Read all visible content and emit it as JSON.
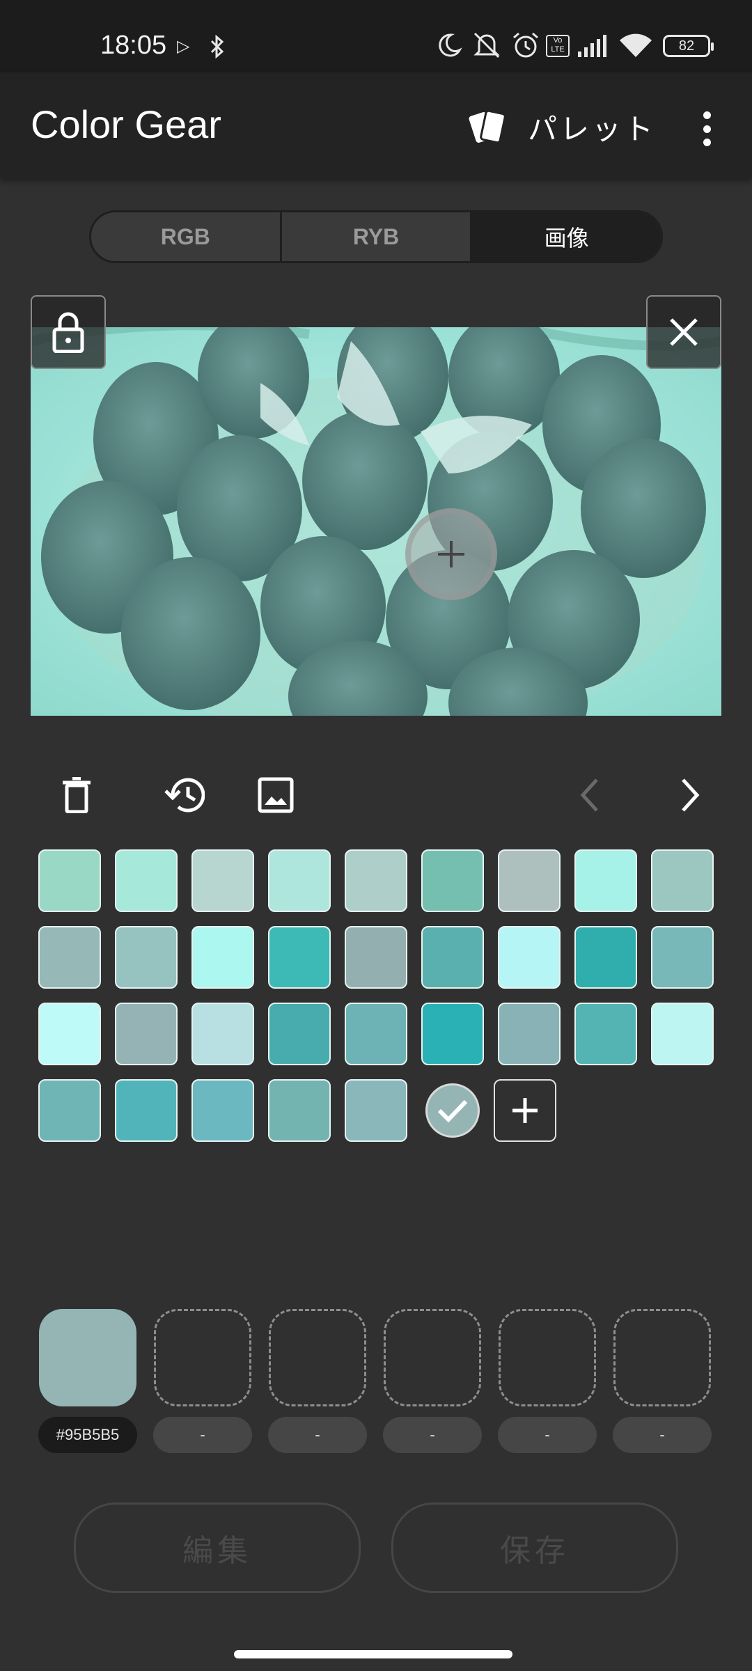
{
  "status_bar": {
    "time": "18:05",
    "battery": "82",
    "icons": [
      "play-store-icon",
      "bluetooth-icon",
      "moon-icon",
      "bell-off-icon",
      "alarm-icon",
      "volte-icon",
      "signal-icon",
      "wifi-icon",
      "battery-icon"
    ]
  },
  "app_bar": {
    "title": "Color Gear",
    "palette_label": "パレット"
  },
  "tabs": [
    {
      "label": "RGB",
      "active": false
    },
    {
      "label": "RYB",
      "active": false
    },
    {
      "label": "画像",
      "active": true
    }
  ],
  "swatches": [
    "#9AD8C6",
    "#A6E8DA",
    "#B8D6D0",
    "#AEE6DE",
    "#AECFC9",
    "#74BFB0",
    "#AEC0BE",
    "#A6F2E9",
    "#9CC7C1",
    "#96B8B7",
    "#96C2BF",
    "#ADF7F1",
    "#3DBAB6",
    "#94AFB0",
    "#5AAFAF",
    "#B6F5F5",
    "#2FAEAD",
    "#78B8B8",
    "#BDFAF8",
    "#95B3B4",
    "#B8E0E3",
    "#48ABAE",
    "#6DB3B5",
    "#2AB1B6",
    "#88B2B5",
    "#54B4B4",
    "#BDF5F2",
    "#6FB5B5",
    "#52B4BB",
    "#6BB8C0",
    "#73B3B0",
    "#8AB8BA"
  ],
  "selected_swatch_color": "#95B5B5",
  "slots": [
    {
      "color": "#95B5B5",
      "label": "#95B5B5",
      "filled": true
    },
    {
      "label": "-",
      "filled": false
    },
    {
      "label": "-",
      "filled": false
    },
    {
      "label": "-",
      "filled": false
    },
    {
      "label": "-",
      "filled": false
    },
    {
      "label": "-",
      "filled": false
    }
  ],
  "buttons": {
    "edit": "編集",
    "save": "保存"
  }
}
